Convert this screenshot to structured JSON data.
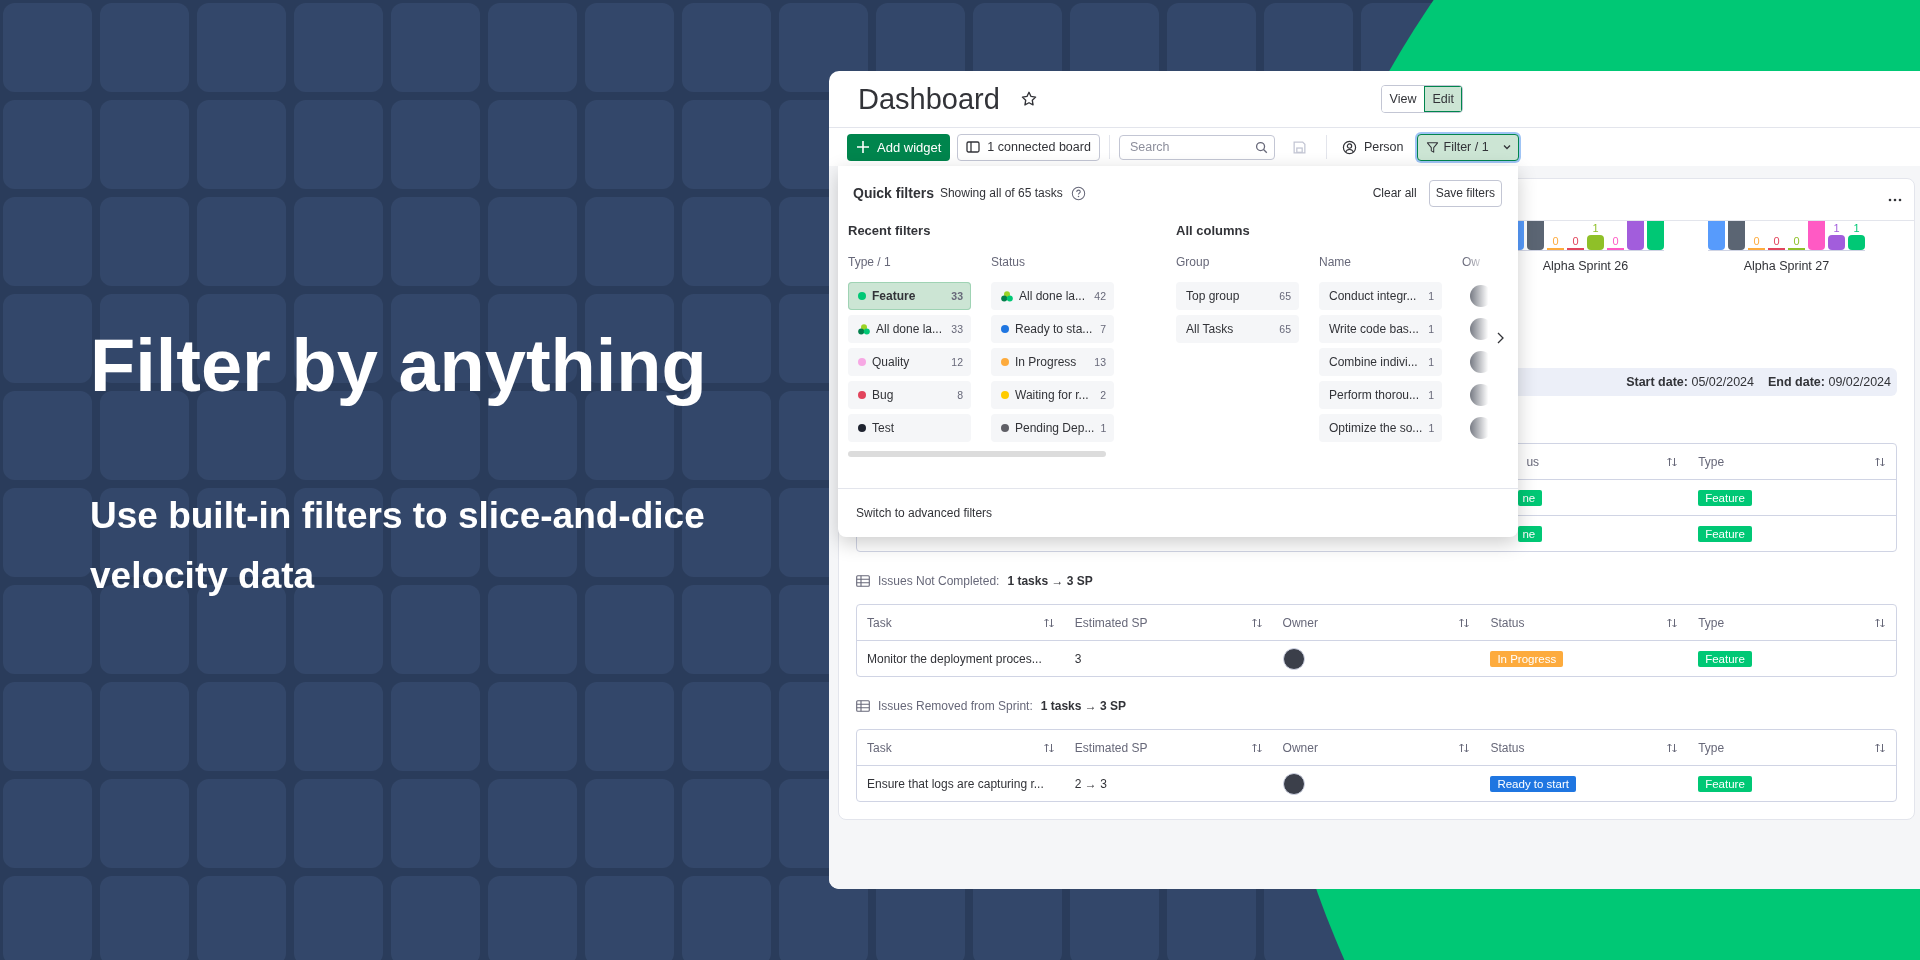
{
  "hero": {
    "title": "Filter by anything",
    "subtitle": "Use built-in filters to slice-and-dice velocity data"
  },
  "dashboard": {
    "title": "Dashboard",
    "modes": [
      {
        "label": "View",
        "selected": false
      },
      {
        "label": "Edit",
        "selected": true
      }
    ]
  },
  "toolbar": {
    "add_widget": "Add widget",
    "connected_boards": "1 connected board",
    "search": {
      "placeholder": "Search"
    },
    "person": "Person",
    "filter": {
      "label": "Filter / 1",
      "active": true
    }
  },
  "quick_filters": {
    "title": "Quick filters",
    "summary": "Showing all of 65 tasks",
    "clear": "Clear all",
    "save": "Save filters",
    "footer": "Switch to advanced filters",
    "recent": {
      "title": "Recent filters",
      "columns": [
        {
          "heading": "Type / 1",
          "items": [
            {
              "kind": "dot",
              "color": "#00c875",
              "label": "Feature",
              "count": "33",
              "selected": true
            },
            {
              "kind": "cluster",
              "label": "All done la...",
              "count": "33",
              "selected": false
            },
            {
              "kind": "dot",
              "color": "#f7a8e4",
              "label": "Quality",
              "count": "12",
              "selected": false
            },
            {
              "kind": "dot",
              "color": "#e2445c",
              "label": "Bug",
              "count": "8",
              "selected": false
            },
            {
              "kind": "dot",
              "color": "#1f2430",
              "label": "Test",
              "selected": false
            }
          ]
        },
        {
          "heading": "Status",
          "items": [
            {
              "kind": "cluster",
              "label": "All done la...",
              "count": "42",
              "selected": false
            },
            {
              "kind": "dot",
              "color": "#1f76e1",
              "label": "Ready to sta...",
              "count": "7",
              "selected": false
            },
            {
              "kind": "dot",
              "color": "#fdab3d",
              "label": "In Progress",
              "count": "13",
              "selected": false
            },
            {
              "kind": "dot",
              "color": "#ffcb00",
              "label": "Waiting for r...",
              "count": "2",
              "selected": false
            },
            {
              "kind": "dot",
              "color": "#5f5f66",
              "label": "Pending Dep...",
              "count": "1",
              "selected": false
            }
          ]
        }
      ]
    },
    "all_columns": {
      "title": "All columns",
      "columns": [
        {
          "heading": "Group",
          "items": [
            {
              "kind": "plain",
              "label": "Top group",
              "count": "65",
              "selected": false
            },
            {
              "kind": "plain",
              "label": "All Tasks",
              "count": "65",
              "selected": false
            }
          ]
        },
        {
          "heading": "Name",
          "items": [
            {
              "kind": "plain",
              "label": "Conduct integr...",
              "count": "1",
              "selected": false
            },
            {
              "kind": "plain",
              "label": "Write code bas...",
              "count": "1",
              "selected": false
            },
            {
              "kind": "plain",
              "label": "Combine indivi...",
              "count": "1",
              "selected": false
            },
            {
              "kind": "plain",
              "label": "Perform thorou...",
              "count": "1",
              "selected": false
            },
            {
              "kind": "plain",
              "label": "Optimize the so...",
              "count": "1",
              "selected": false
            }
          ]
        },
        {
          "heading": "Ow",
          "items": [
            {
              "kind": "avatar"
            },
            {
              "kind": "avatar"
            },
            {
              "kind": "avatar"
            },
            {
              "kind": "avatar"
            },
            {
              "kind": "avatar"
            }
          ]
        }
      ]
    }
  },
  "chart": {
    "groups": [
      {
        "label": "Alpha Sprint 26",
        "bars": [
          {
            "kind": "tall",
            "color": "#579bfc"
          },
          {
            "kind": "tall",
            "color": "#5b6573"
          },
          {
            "kind": "zero",
            "color": "#fdab3d",
            "value": "0"
          },
          {
            "kind": "zero",
            "color": "#e2445c",
            "value": "0"
          },
          {
            "kind": "short",
            "color": "#8fc028",
            "value": "1"
          },
          {
            "kind": "zero",
            "color": "#ff5ac4",
            "value": "0"
          },
          {
            "kind": "tall",
            "color": "#a25ddc"
          },
          {
            "kind": "tall",
            "color": "#00c875"
          }
        ]
      },
      {
        "label": "Alpha Sprint 27",
        "bars": [
          {
            "kind": "tall",
            "color": "#579bfc"
          },
          {
            "kind": "tall",
            "color": "#5b6573"
          },
          {
            "kind": "zero",
            "color": "#fdab3d",
            "value": "0"
          },
          {
            "kind": "zero",
            "color": "#e2445c",
            "value": "0"
          },
          {
            "kind": "zero",
            "color": "#8fc028",
            "value": "0"
          },
          {
            "kind": "tall",
            "color": "#ff5ac4"
          },
          {
            "kind": "short",
            "color": "#a25ddc",
            "value": "1"
          },
          {
            "kind": "short",
            "color": "#00c875",
            "value": "1"
          }
        ]
      }
    ]
  },
  "dates": [
    {
      "label": "Start date:",
      "value": "05/02/2024"
    },
    {
      "label": "End date:",
      "value": "09/02/2024"
    }
  ],
  "partial_table": {
    "columns": [
      "us",
      "Type"
    ],
    "rows": [
      {
        "status": {
          "label": "ne",
          "color": "#00c875"
        },
        "type": {
          "label": "Feature",
          "color": "#00c875"
        }
      },
      {
        "status": {
          "label": "ne",
          "color": "#00c875"
        },
        "type": {
          "label": "Feature",
          "color": "#00c875"
        }
      }
    ]
  },
  "tables": [
    {
      "title": "Issues Not Completed:",
      "summary": "1 tasks → 3 SP",
      "columns": [
        "Task",
        "Estimated SP",
        "Owner",
        "Status",
        "Type"
      ],
      "rows": [
        {
          "task": "Monitor the deployment proces...",
          "sp": "3",
          "owner_visible": true,
          "status": {
            "label": "In Progress",
            "color": "#fdab3d"
          },
          "type": {
            "label": "Feature",
            "color": "#00c875"
          }
        }
      ]
    },
    {
      "title": "Issues Removed from Sprint:",
      "summary": "1 tasks → 3 SP",
      "columns": [
        "Task",
        "Estimated SP",
        "Owner",
        "Status",
        "Type"
      ],
      "rows": [
        {
          "task": "Ensure that logs are capturing r...",
          "sp": "2 → 3",
          "owner_visible": true,
          "status": {
            "label": "Ready to start",
            "color": "#1f76e1"
          },
          "type": {
            "label": "Feature",
            "color": "#00c875"
          }
        }
      ]
    }
  ]
}
